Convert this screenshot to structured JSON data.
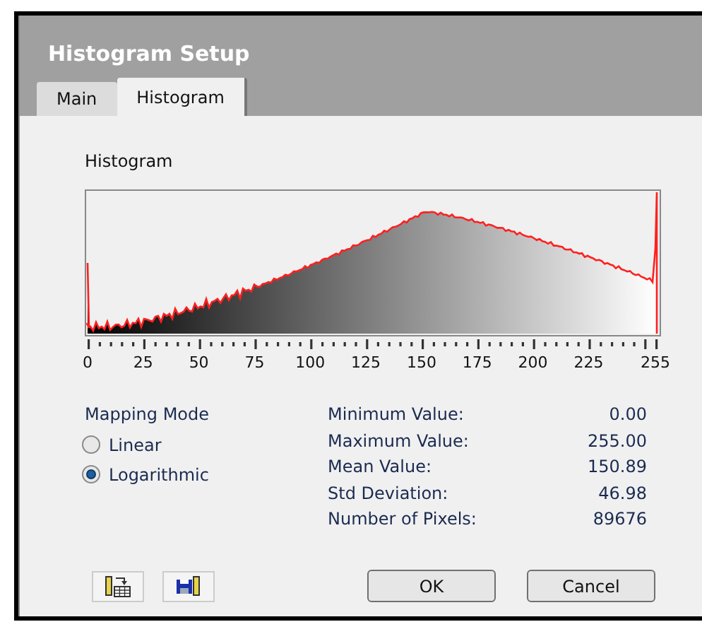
{
  "window": {
    "title": "Histogram Setup"
  },
  "tabs": [
    {
      "label": "Main",
      "selected": false
    },
    {
      "label": "Histogram",
      "selected": true
    }
  ],
  "histogram": {
    "label": "Histogram",
    "x_axis_labels": [
      "0",
      "25",
      "50",
      "75",
      "100",
      "125",
      "150",
      "175",
      "200",
      "225",
      "255"
    ]
  },
  "mapping_mode": {
    "label": "Mapping Mode",
    "options": [
      {
        "label": "Linear",
        "selected": false
      },
      {
        "label": "Logarithmic",
        "selected": true
      }
    ]
  },
  "statistics": [
    {
      "label": "Minimum Value:",
      "value": "0.00"
    },
    {
      "label": "Maximum Value:",
      "value": "255.00"
    },
    {
      "label": "Mean Value:",
      "value": "150.89"
    },
    {
      "label": "Std Deviation:",
      "value": "46.98"
    },
    {
      "label": "Number of Pixels:",
      "value": "89676"
    }
  ],
  "tool_buttons": [
    {
      "kind": "load"
    },
    {
      "kind": "save"
    }
  ],
  "buttons": [
    "OK",
    "Cancel"
  ]
}
